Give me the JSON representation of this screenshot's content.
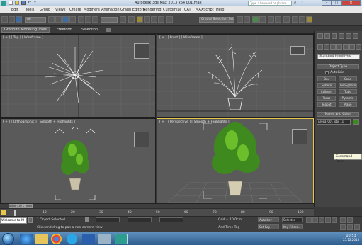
{
  "window": {
    "title": "Autodesk 3ds Max 2013 x64      001.max",
    "search_placeholder": "Type a keyword or phrase",
    "min_label": "–",
    "max_label": "□",
    "close_label": "✕"
  },
  "menu": [
    "Edit",
    "Tools",
    "Group",
    "Views",
    "Create",
    "Modifiers",
    "Animation",
    "Graph Editors",
    "Rendering",
    "Customize",
    "CAT",
    "MAXScript",
    "Help"
  ],
  "toolbar": {
    "selection_filter": "All",
    "named_selection": "Create Selection Set"
  },
  "ribbon": {
    "tabs": [
      "Graphite Modeling Tools",
      "Freeform",
      "Selection"
    ]
  },
  "viewports": {
    "top": "[ + ] [ Top ] [ Wireframe ]",
    "front": "[ + ] [ Front ] [ Wireframe ]",
    "ortho": "[ + ] [ Orthographic ] [ Smooth + Highlights ]",
    "perspective": "[ + ] [ Perspective ] [ Smooth + Highlights ]"
  },
  "command_panel": {
    "dropdown": "Standard Primitives",
    "rollout_object_type": "Object Type",
    "autogrid": "AutoGrid",
    "buttons": [
      "Box",
      "Cone",
      "Sphere",
      "GeoSphere",
      "Cylinder",
      "Tube",
      "Torus",
      "Pyramid",
      "Teapot",
      "Plane"
    ],
    "rollout_name_color": "Name and Color",
    "object_name": "Areca_001_obj_11"
  },
  "tooltip": "Command Panel",
  "timeline": {
    "slider_label": "0 / 100",
    "ticks": [
      "0",
      "10",
      "20",
      "30",
      "40",
      "50",
      "60",
      "70",
      "80",
      "90",
      "100"
    ]
  },
  "status": {
    "maxscript": "Welcome to M",
    "message": "1 Object Selected",
    "prompt": "Click and drag to pan a non-camera view",
    "grid": "Grid = 10,0cm",
    "add_time_tag": "Add Time Tag",
    "auto_key": "Auto Key",
    "set_key": "Set Key",
    "selected": "Selected",
    "key_filters": "Key Filters..."
  },
  "taskbar": {
    "time": "10:53",
    "date": "25.12.2013"
  },
  "colors": {
    "active_border": "#e8c84a",
    "viewport_bg": "#5a5a5a",
    "plant_green": "#3f8a1e"
  }
}
